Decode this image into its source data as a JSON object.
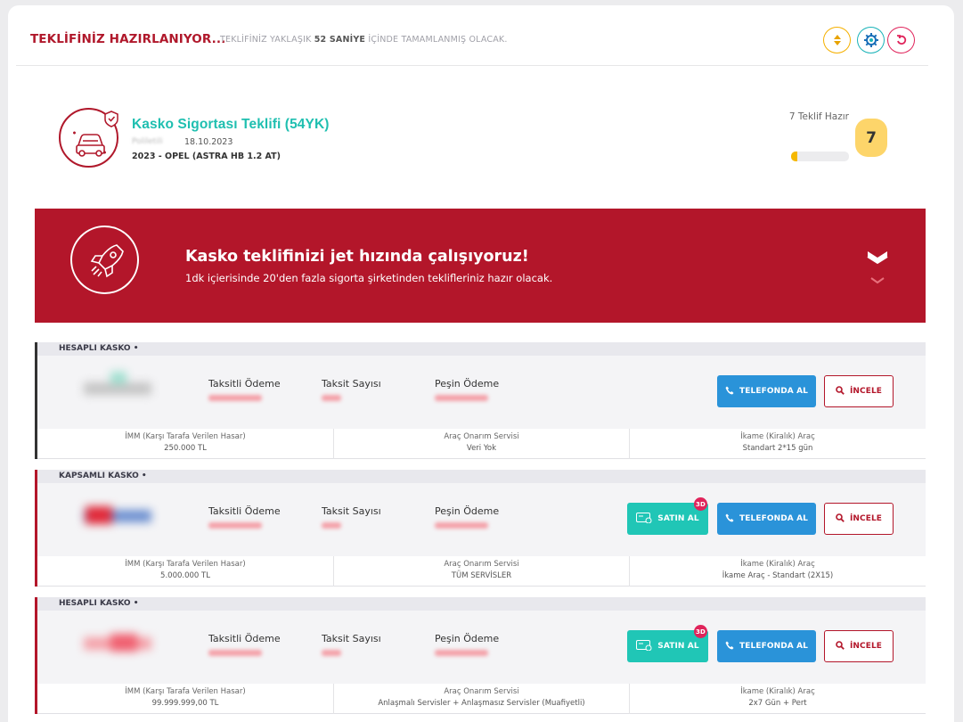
{
  "header": {
    "title": "TEKLİFİNİZ HAZIRLANIYOR...",
    "subtitle_pre": "TEKLİFİNİZ YAKLAŞIK",
    "subtitle_bold": "52 SANİYE",
    "subtitle_post": "İÇİNDE TAMAMLANMIŞ OLACAK.",
    "icons": [
      "sort-icon",
      "settings-gear-icon",
      "refresh-icon"
    ],
    "accent_color": "#b0182b"
  },
  "quote": {
    "title": "Kasko Sigortası Teklifi (54YK)",
    "blurred_number": "Poliletili",
    "date": "18.10.2023",
    "vehicle": "2023 - OPEL (ASTRA HB 1.2 AT)",
    "ready_label": "7 Teklif Hazır",
    "ready_count": "7",
    "progress_fraction": 0.1
  },
  "banner": {
    "title": "Kasko teklifinizi jet hızında çalışıyoruz!",
    "subtitle": "1dk içierisinde 20'den fazla sigorta şirketinden teklifleriniz hazır olacak.",
    "color": "#b3162a"
  },
  "labels": {
    "installment_payment": "Taksitli Ödeme",
    "installment_count": "Taksit Sayısı",
    "cash_payment": "Peşin Ödeme",
    "buy": "SATIN AL",
    "buy_badge": "3D",
    "phone": "TELEFONDA AL",
    "inspect": "İNCELE",
    "imm_label": "İMM (Karşı Tarafa Verilen Hasar)",
    "repair_label": "Araç Onarım Servisi",
    "rental_label": "İkame (Kiralık) Araç"
  },
  "offers": [
    {
      "type": "HESAPLI KASKO •",
      "show_buy": false,
      "imm": "250.000 TL",
      "repair": "Veri Yok",
      "rental": "Standart 2*15 gün"
    },
    {
      "type": "KAPSAMLI KASKO •",
      "show_buy": true,
      "imm": "5.000.000 TL",
      "repair": "TÜM SERVİSLER",
      "rental": "İkame Araç - Standart (2X15)"
    },
    {
      "type": "HESAPLI KASKO •",
      "show_buy": true,
      "imm": "99.999.999,00 TL",
      "repair": "Anlaşmalı Servisler + Anlaşmasız Servisler (Muafiyetli)",
      "rental": "2x7 Gün + Pert"
    }
  ]
}
